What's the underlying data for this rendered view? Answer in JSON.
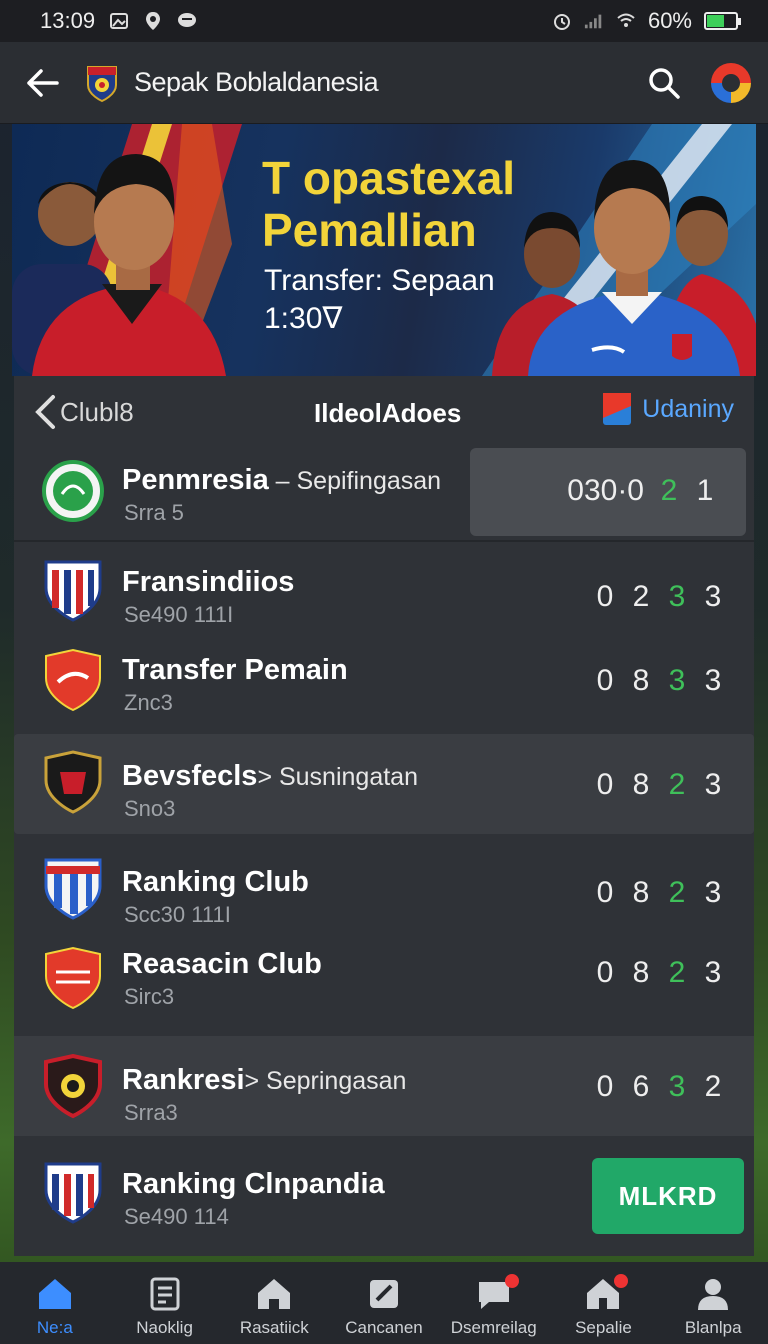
{
  "status_bar": {
    "time": "13:09",
    "battery": "60%",
    "battery_level": 0.6,
    "icons": [
      "gallery-icon",
      "location-icon",
      "chat-icon",
      "alarm-icon",
      "signal-icon",
      "wifi-icon",
      "battery-icon"
    ]
  },
  "app_bar": {
    "title": "Sepak Boblaldanesia",
    "icons": [
      "back-arrow-icon",
      "app-logo-icon",
      "search-icon",
      "profile-icon"
    ]
  },
  "banner": {
    "title": "T opastexal Pemallian",
    "subtitle": "Transfer: Sepaan 1:30∇"
  },
  "list_header": {
    "left": "Clubl8",
    "center": "IldeolAdoes",
    "right": "Udaniny",
    "icons": [
      "chevron-left-icon",
      "flag-icon"
    ]
  },
  "clubs": [
    {
      "name": "Penmresia",
      "suffix": " – Sepifingasan",
      "sub": "Srra 5",
      "scores": [
        "030·0",
        "2",
        "1"
      ],
      "highlight_index": 1,
      "crest_color": "#2aa14a"
    },
    {
      "name": "Fransindiios",
      "suffix": "",
      "sub": "Se490 111I",
      "scores": [
        "0",
        "2",
        "3",
        "3"
      ],
      "highlight_index": 2,
      "crest_color": "#d12a2a"
    },
    {
      "name": "Transfer Pemain",
      "suffix": "",
      "sub": "Znc3",
      "scores": [
        "0",
        "8",
        "3",
        "3"
      ],
      "highlight_index": 2,
      "crest_color": "#e23a2a"
    },
    {
      "name": "Bevsfecls",
      "suffix": "> Susningatan",
      "sub": "Sno3",
      "scores": [
        "0",
        "8",
        "2",
        "3"
      ],
      "highlight_index": 2,
      "crest_color": "#1a1a1a"
    },
    {
      "name": "Ranking Club",
      "suffix": "",
      "sub": "Scc30 111I",
      "scores": [
        "0",
        "8",
        "2",
        "3"
      ],
      "highlight_index": 2,
      "crest_color": "#2a5fc9"
    },
    {
      "name": "Reasacin Club",
      "suffix": "",
      "sub": "Sirc3",
      "scores": [
        "0",
        "8",
        "2",
        "3"
      ],
      "highlight_index": 2,
      "crest_color": "#e23a2a"
    },
    {
      "name": "Rankresi",
      "suffix": "> Sepringasan",
      "sub": "Srra3",
      "scores": [
        "0",
        "6",
        "3",
        "2"
      ],
      "highlight_index": 2,
      "crest_color": "#7a1a2a"
    },
    {
      "name": "Ranking Clnpandia",
      "suffix": "",
      "sub": "Se490 114",
      "button": "MLKRD",
      "crest_color": "#d12a2a"
    }
  ],
  "bottom_nav": [
    {
      "label": "Ne:a",
      "icon": "home-icon",
      "active": true,
      "badge": false
    },
    {
      "label": "Naoklig",
      "icon": "document-icon",
      "active": false,
      "badge": false
    },
    {
      "label": "Rasatiick",
      "icon": "house-icon",
      "active": false,
      "badge": false
    },
    {
      "label": "Cancanen",
      "icon": "ticket-icon",
      "active": false,
      "badge": false
    },
    {
      "label": "Dsemreilag",
      "icon": "chat-icon",
      "active": false,
      "badge": true
    },
    {
      "label": "Sepalie",
      "icon": "store-icon",
      "active": false,
      "badge": true
    },
    {
      "label": "Blanlpa",
      "icon": "person-icon",
      "active": false,
      "badge": false
    }
  ],
  "colors": {
    "accent_blue": "#3d8eff",
    "score_green": "#3fc05a",
    "button_green": "#21a868",
    "banner_yellow": "#f2d43a"
  }
}
